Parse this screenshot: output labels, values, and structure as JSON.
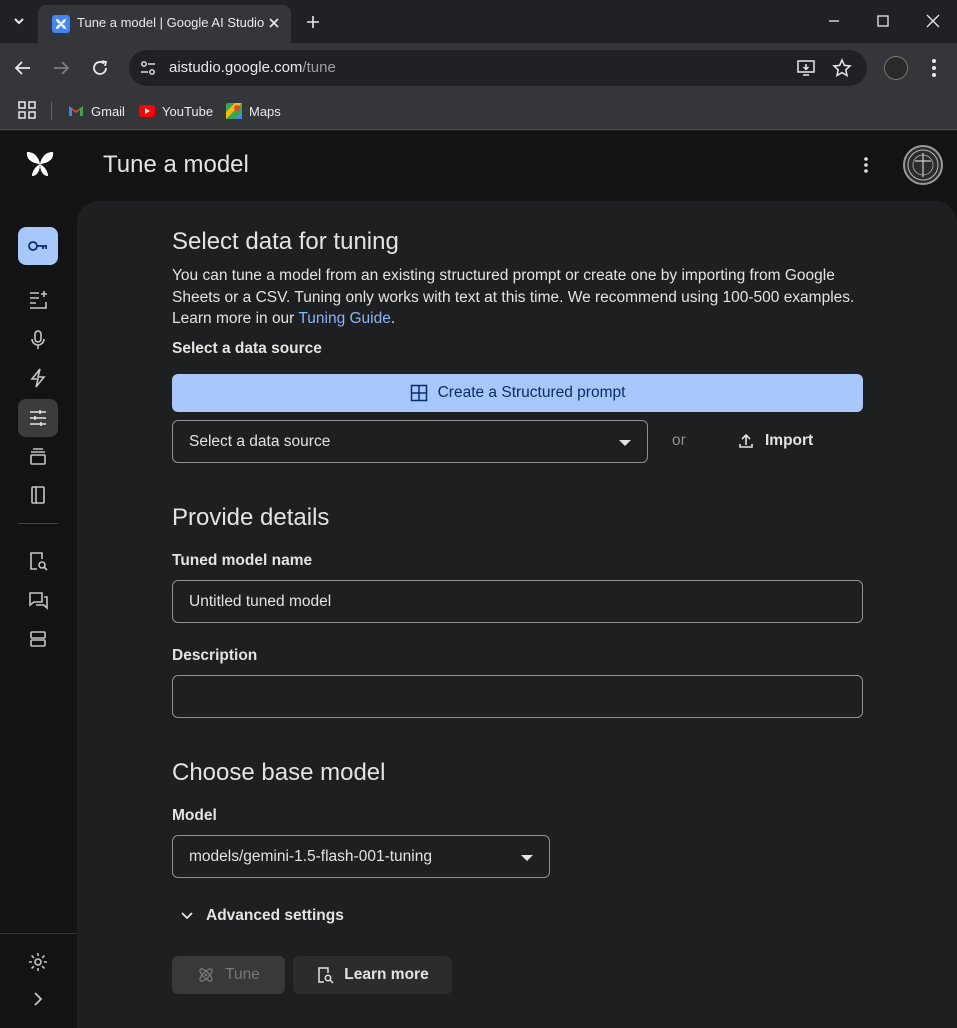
{
  "browser": {
    "tab": {
      "title": "Tune a model | Google AI Studio"
    },
    "url": {
      "host": "aistudio.google.com",
      "path": "/tune"
    },
    "bookmarks": [
      {
        "label": "Gmail",
        "icon": "gmail-icon"
      },
      {
        "label": "YouTube",
        "icon": "youtube-icon"
      },
      {
        "label": "Maps",
        "icon": "maps-icon"
      }
    ]
  },
  "header": {
    "title": "Tune a model"
  },
  "sidebar": {
    "items": [
      {
        "name": "key-icon",
        "active": true
      },
      {
        "name": "new-prompt-icon"
      },
      {
        "name": "microphone-icon"
      },
      {
        "name": "bolt-icon"
      },
      {
        "name": "tune-icon",
        "current": true
      },
      {
        "name": "library-icon"
      },
      {
        "name": "book-icon"
      },
      {
        "name": "document-search-icon"
      },
      {
        "name": "chat-icon"
      },
      {
        "name": "storage-icon"
      },
      {
        "name": "settings-icon"
      },
      {
        "name": "expand-icon"
      }
    ]
  },
  "select_data": {
    "heading": "Select data for tuning",
    "description_pre": "You can tune a model from an existing structured prompt or create one by importing from Google Sheets or a CSV. Tuning only works with text at this time. We recommend using 100-500 examples. Learn more in our ",
    "description_link": "Tuning Guide",
    "description_post": ".",
    "source_label": "Select a data source",
    "create_button": "Create a Structured prompt",
    "source_select": "Select a data source",
    "or": "or",
    "import_button": "Import"
  },
  "details": {
    "heading": "Provide details",
    "name_label": "Tuned model name",
    "name_value": "Untitled tuned model",
    "description_label": "Description",
    "description_value": ""
  },
  "base_model": {
    "heading": "Choose base model",
    "model_label": "Model",
    "model_value": "models/gemini-1.5-flash-001-tuning",
    "advanced": "Advanced settings"
  },
  "actions": {
    "tune": "Tune",
    "learn_more": "Learn more"
  },
  "colors": {
    "accent": "#a8c7fa",
    "link": "#8ab4f8",
    "panel": "#1e1f20",
    "background": "#131314"
  }
}
